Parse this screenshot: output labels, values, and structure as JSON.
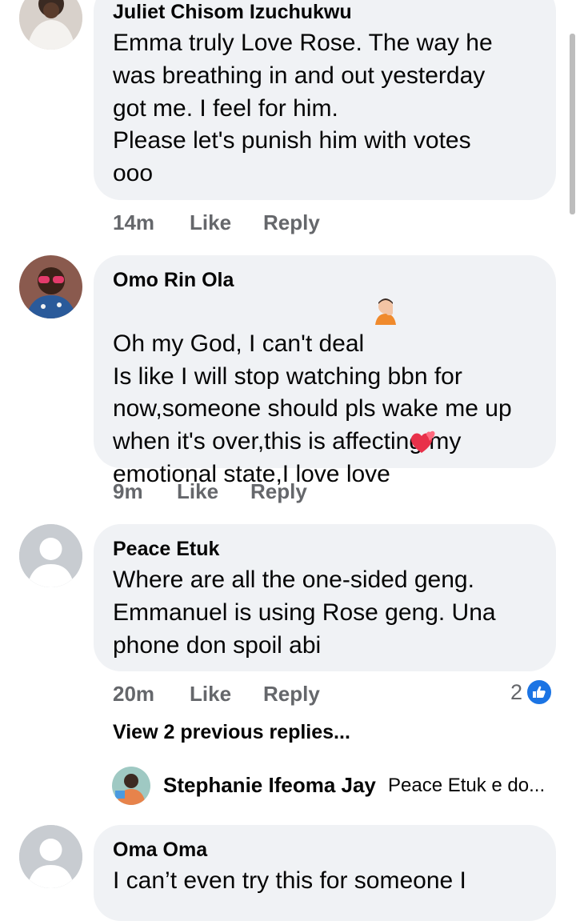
{
  "comments": [
    {
      "author": "Juliet Chisom Izuchukwu",
      "text": "Emma truly Love Rose. The way he\nwas breathing in and out yesterday\ngot me. I feel for him.\nPlease let's punish him with votes\nooo",
      "time": "14m",
      "like_label": "Like",
      "reply_label": "Reply"
    },
    {
      "author": "Omo Rin Ola",
      "text": "Oh my God, I can't deal\nIs like I will stop watching bbn for\nnow,someone should pls wake me up\nwhen it's over,this is affecting my\nemotional state,I love love",
      "time": "9m",
      "like_label": "Like",
      "reply_label": "Reply"
    },
    {
      "author": "Peace Etuk",
      "text": "Where are all the one-sided geng.\nEmmanuel is using Rose geng. Una\nphone don spoil abi",
      "time": "20m",
      "like_label": "Like",
      "reply_label": "Reply",
      "reaction_count": "2",
      "view_previous": "View 2 previous replies...",
      "reply_preview": {
        "author": "Stephanie Ifeoma Jay",
        "text": "Peace Etuk e do..."
      }
    },
    {
      "author": "Oma Oma",
      "text": "I can’t even try this for someone I",
      "time": "",
      "like_label": "",
      "reply_label": ""
    }
  ],
  "icons": {
    "like_reaction": "thumbs-up-icon",
    "default_avatar": "person-icon",
    "facepalm_emoji": "person-facepalming-emoji",
    "hearts_emoji": "revolving-hearts-emoji"
  },
  "colors": {
    "bubble": "#f0f2f5",
    "meta_text": "#65676b",
    "like_blue": "#1b74e4"
  }
}
